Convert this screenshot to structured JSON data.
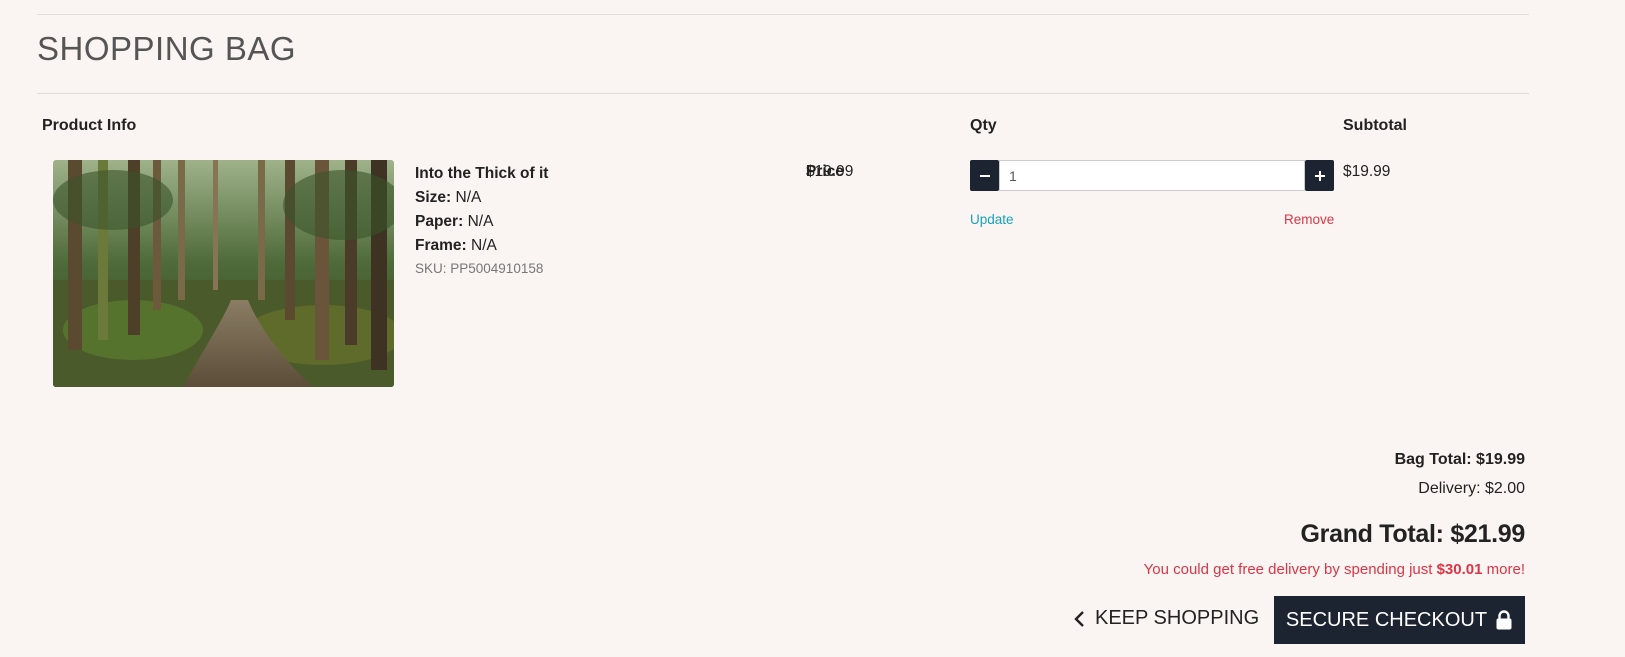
{
  "page": {
    "title": "SHOPPING BAG"
  },
  "table": {
    "headers": {
      "product_info": "Product Info",
      "price": "Price",
      "qty": "Qty",
      "subtotal": "Subtotal"
    }
  },
  "item": {
    "name": "Into the Thick of it",
    "size_label": "Size:",
    "size_value": "N/A",
    "paper_label": "Paper:",
    "paper_value": "N/A",
    "frame_label": "Frame:",
    "frame_value": "N/A",
    "sku": "SKU: PP5004910158",
    "price": "$19.99",
    "quantity": "1",
    "subtotal": "$19.99",
    "update_label": "Update",
    "remove_label": "Remove",
    "minus_icon": "minus-icon",
    "plus_icon": "plus-icon"
  },
  "summary": {
    "bag_total": "Bag Total: $19.99",
    "delivery": "Delivery: $2.00",
    "grand_total": "Grand Total: $21.99",
    "promo_prefix": "You could get free delivery by spending just ",
    "promo_amount": "$30.01",
    "promo_suffix": " more!"
  },
  "actions": {
    "keep_shopping": "KEEP SHOPPING",
    "secure_checkout": "SECURE CHECKOUT"
  },
  "colors": {
    "primary_dark": "#1c2331",
    "danger": "#dc3545",
    "info": "#17a2b8",
    "background": "#faf5f2"
  }
}
